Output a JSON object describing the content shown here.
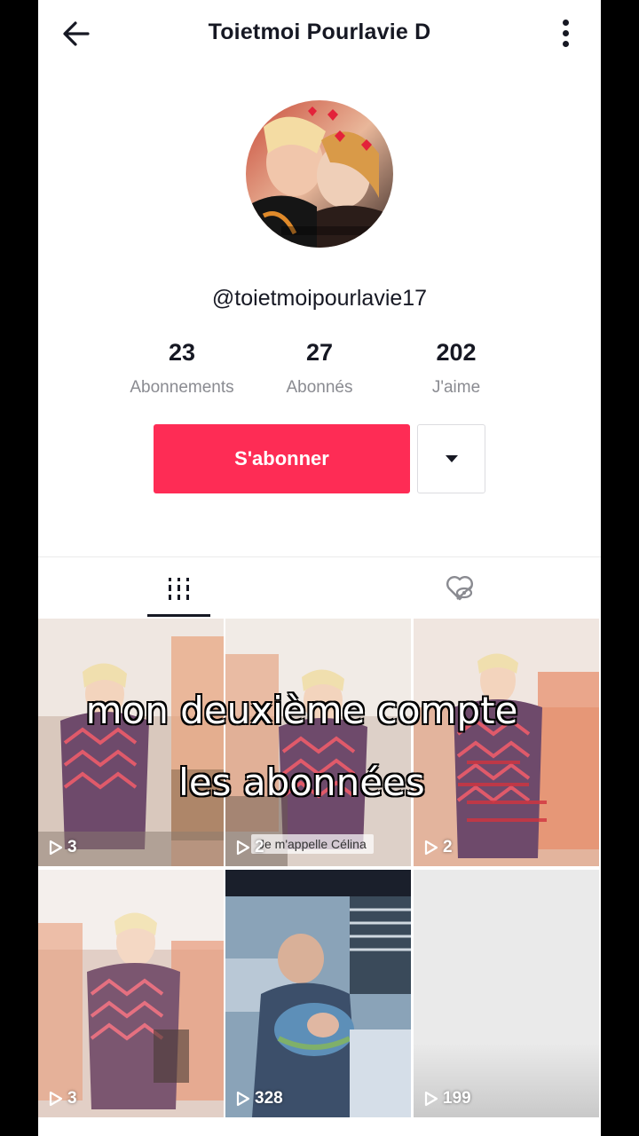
{
  "header": {
    "title": "Toietmoi Pourlavie D"
  },
  "profile": {
    "username": "@toietmoipourlavie17",
    "stats": [
      {
        "value": "23",
        "label": "Abonnements"
      },
      {
        "value": "27",
        "label": "Abonnés"
      },
      {
        "value": "202",
        "label": "J'aime"
      }
    ],
    "follow_label": "S'abonner"
  },
  "tabs": [
    {
      "icon": "video-grid-icon",
      "active": true
    },
    {
      "icon": "liked-videos-hidden-icon",
      "active": false
    }
  ],
  "videos": [
    {
      "views": "3"
    },
    {
      "views": "2",
      "caption": "Je m'appelle Célina"
    },
    {
      "views": "2"
    },
    {
      "views": "3"
    },
    {
      "views": "328"
    },
    {
      "views": "199"
    }
  ],
  "overlay_text": {
    "line1": "mon deuxième  compte",
    "line2": "les abonnées"
  },
  "colors": {
    "accent": "#fe2c55",
    "text": "#161823",
    "muted": "#8a8b91"
  }
}
